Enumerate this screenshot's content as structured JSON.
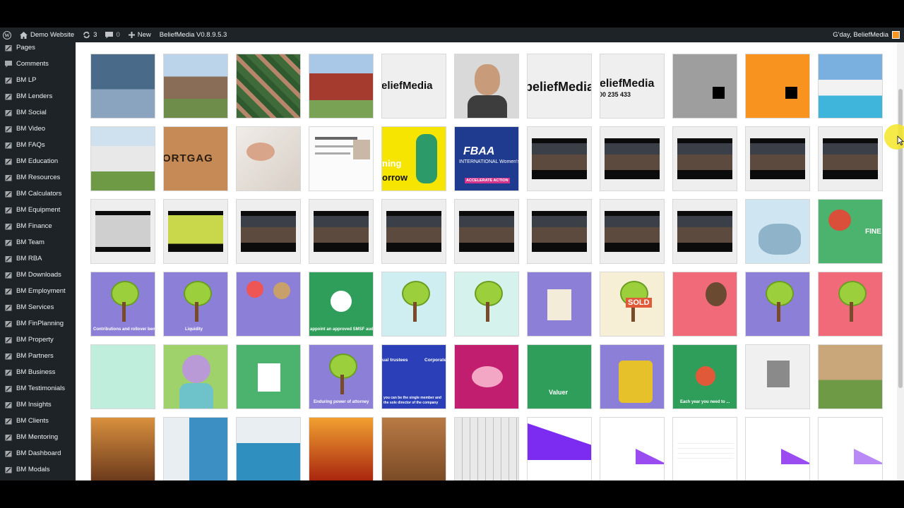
{
  "adminbar": {
    "site_name": "Demo Website",
    "updates_count": "3",
    "comments_count": "0",
    "new_label": "New",
    "plugin_label": "BeliefMedia V0.8.9.5.3",
    "greeting": "G'day, BeliefMedia"
  },
  "sidebar": {
    "items": [
      "Pages",
      "Comments",
      "BM LP",
      "BM Lenders",
      "BM Social",
      "BM Video",
      "BM FAQs",
      "BM Education",
      "BM Resources",
      "BM Calculators",
      "BM Equipment",
      "BM Finance",
      "BM Team",
      "BM RBA",
      "BM Downloads",
      "BM Employment",
      "BM Services",
      "BM FinPlanning",
      "BM Property",
      "BM Partners",
      "BM Business",
      "BM Testimonials",
      "BM Insights",
      "BM Clients",
      "BM Mentoring",
      "BM Dashboard",
      "BM Modals"
    ]
  },
  "media": {
    "texts": {
      "belief_a": "eliefMedia",
      "belief_b": "beliefMedia",
      "belief_c": "eliefMedia",
      "phone": "00 235 433",
      "mortgage": "ORTGAG",
      "tomorrow_top": "ning",
      "tomorrow_bottom": "orrow",
      "fbaa": "FBAA",
      "womens_day": "INTERNATIONAL Women's Day",
      "accelerate": "ACCELERATE ACTION",
      "fine": "FINE",
      "contributions": "Contributions and rollover benefits",
      "liquidity": "Liquidity",
      "smsf": "appoint an approved SMSF auditor",
      "sold": "SOLD",
      "enduring": "Enduring power of attorney",
      "trustees_left": "ual trustees",
      "trustees_right": "Corporate",
      "director": "you can be the single member and the sole director of the company",
      "valuer": "Valuer",
      "each_year": "Each year you need to ..."
    }
  },
  "colors": {
    "admin_bg": "#1d2327",
    "orange_tile": "#f7931e",
    "purple_tile": "#8b7fd8",
    "green_tile": "#2f9e5a"
  }
}
